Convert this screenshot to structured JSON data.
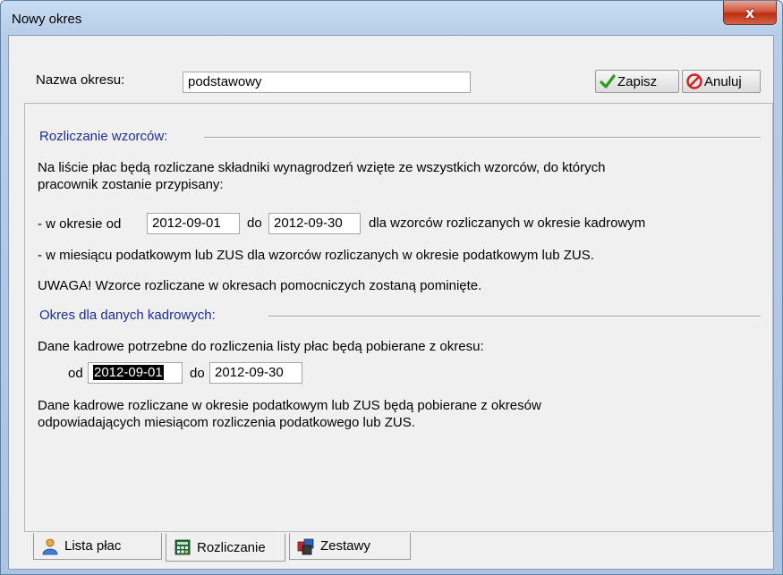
{
  "window": {
    "title": "Nowy okres",
    "close_glyph": "x"
  },
  "header": {
    "name_label": "Nazwa okresu:",
    "name_value": "podstawowy",
    "save_label": "Zapisz",
    "cancel_label": "Anuluj"
  },
  "settlement": {
    "section_title": "Rozliczanie wzorców:",
    "intro_line1": "Na liście płac będą rozliczane składniki wynagrodzeń wzięte ze wszystkich wzorców, do których",
    "intro_line2": "pracownik zostanie przypisany:",
    "period_prefix": "- w okresie od",
    "from_value": "2012-09-01",
    "to_label": "do",
    "to_value": "2012-09-30",
    "period_suffix": "dla wzorców rozliczanych w okresie kadrowym",
    "tax_line": "- w miesiącu podatkowym lub ZUS dla wzorców rozliczanych w okresie podatkowym lub ZUS.",
    "warning": "UWAGA! Wzorce rozliczane w okresach pomocniczych zostaną pominięte."
  },
  "hr_data": {
    "section_title": "Okres dla danych kadrowych:",
    "desc": "Dane kadrowe potrzebne do rozliczenia listy płac będą pobierane z okresu:",
    "from_label": "od",
    "from_value": "2012-09-01",
    "to_label": "do",
    "to_value": "2012-09-30",
    "note_line1": "Dane kadrowe rozliczane w okresie podatkowym lub ZUS będą pobierane z okresów",
    "note_line2": "odpowiadających miesiącom rozliczenia podatkowego lub ZUS."
  },
  "tabs": [
    {
      "label": "Lista płac",
      "icon": "person-icon",
      "active": false
    },
    {
      "label": "Rozliczanie",
      "icon": "calculator-icon",
      "active": true
    },
    {
      "label": "Zestawy",
      "icon": "sets-icon",
      "active": false
    }
  ],
  "colors": {
    "section_title": "#1b2d9a",
    "save_check": "#2e9a1e",
    "cancel_icon": "#d42020",
    "close_button": "#c7452a"
  }
}
